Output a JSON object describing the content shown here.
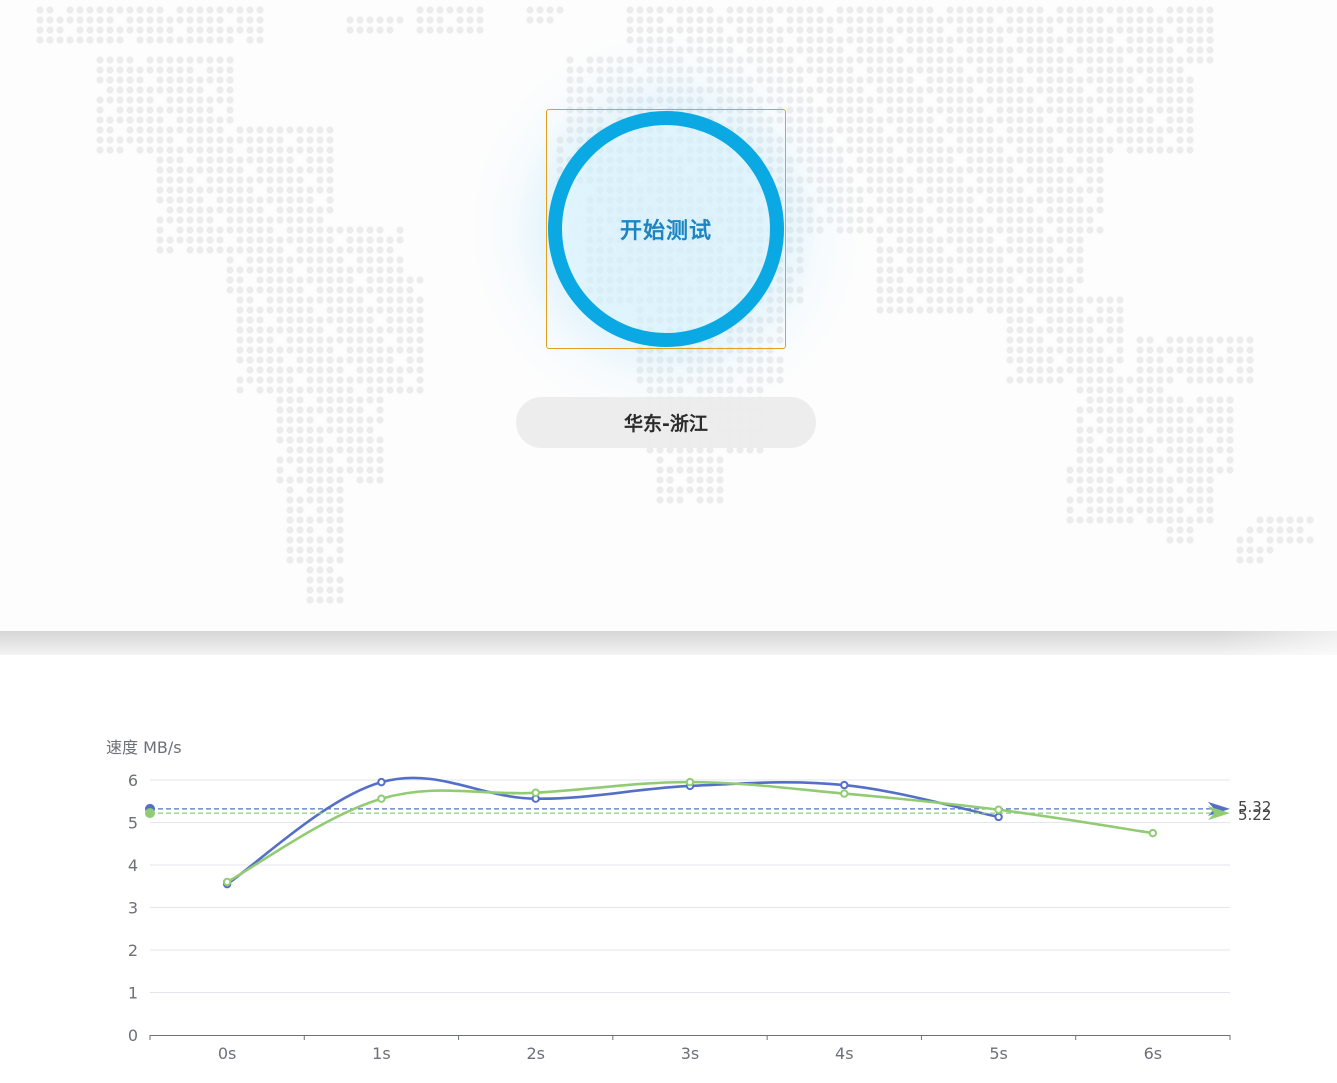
{
  "start_button": {
    "label": "开始测试"
  },
  "node": {
    "label": "华东-浙江"
  },
  "colors": {
    "accent": "#0aa9e4",
    "series1": "#5470c6",
    "series2": "#91cc75"
  },
  "chart_data": {
    "type": "line",
    "ylabel": "速度 MB/s",
    "ylim": [
      0,
      6
    ],
    "yticks": [
      "0",
      "1",
      "2",
      "3",
      "4",
      "5",
      "6"
    ],
    "categories": [
      "0s",
      "1s",
      "2s",
      "3s",
      "4s",
      "5s",
      "6s"
    ],
    "grid": true,
    "smooth": true,
    "series": [
      {
        "values": [
          3.55,
          5.95,
          5.56,
          5.86,
          5.88,
          5.13
        ],
        "color": "#5470c6",
        "average": 5.32,
        "average_label": "5.32"
      },
      {
        "values": [
          3.6,
          5.56,
          5.7,
          5.95,
          5.68,
          5.3,
          4.75
        ],
        "color": "#91cc75",
        "average": 5.22,
        "average_label": "5.22"
      }
    ]
  }
}
